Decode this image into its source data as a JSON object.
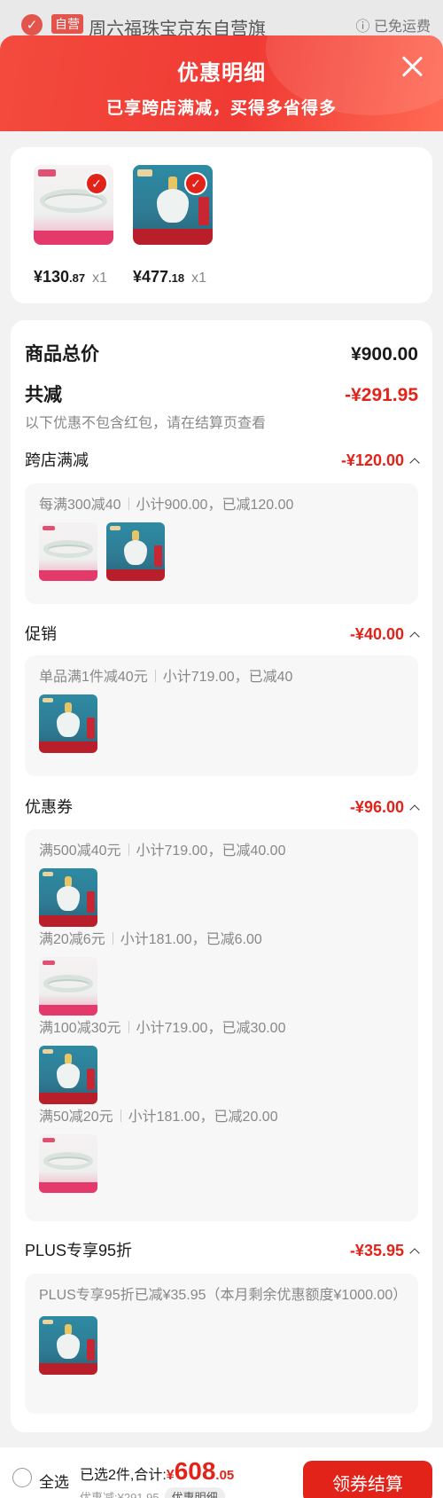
{
  "backdrop": {
    "tag": "自营",
    "store_name": "周六福珠宝京东自营旗",
    "shipping": "ⓘ 已免运费"
  },
  "sheet": {
    "title": "优惠明细",
    "subtitle": "已享跨店满减，买得多省得多"
  },
  "products": [
    {
      "price_int": "¥130",
      "price_dec": ".87",
      "qty": "x1",
      "image": "bangle"
    },
    {
      "price_int": "¥477",
      "price_dec": ".18",
      "qty": "x1",
      "image": "pendant"
    }
  ],
  "summary": {
    "total_label": "商品总价",
    "total_value": "¥900.00",
    "discount_label": "共减",
    "discount_value": "-¥291.95",
    "note": "以下优惠不包含红包，请在结算页查看"
  },
  "sections": {
    "cross_store": {
      "label": "跨店满减",
      "value": "-¥120.00",
      "rule": "每满300减40",
      "detail": "小计900.00，已减120.00"
    },
    "promotion": {
      "label": "促销",
      "value": "-¥40.00",
      "rule": "单品满1件减40元",
      "detail": "小计719.00，已减40"
    },
    "coupon": {
      "label": "优惠券",
      "value": "-¥96.00",
      "items": [
        {
          "rule": "满500减40元",
          "detail": "小计719.00，已减40.00",
          "image": "pendant"
        },
        {
          "rule": "满20减6元",
          "detail": "小计181.00，已减6.00",
          "image": "bangle"
        },
        {
          "rule": "满100减30元",
          "detail": "小计719.00，已减30.00",
          "image": "pendant"
        },
        {
          "rule": "满50减20元",
          "detail": "小计181.00，已减20.00",
          "image": "bangle"
        }
      ]
    },
    "plus": {
      "label": "PLUS专享95折",
      "value": "-¥35.95",
      "text": "PLUS专享95折已减¥35.95（本月剩余优惠额度¥1000.00）"
    }
  },
  "bottom": {
    "select_all": "全选",
    "selected": "已选2件,合计:",
    "total_symbol": "¥",
    "total_int": "608",
    "total_dec": ".05",
    "saved": "优惠减:¥291.95",
    "detail_link": "优惠明细",
    "checkout": "领券结算"
  },
  "colors": {
    "accent": "#e2231a",
    "header_start": "#f34b3e",
    "header_end": "#ff6a54"
  }
}
